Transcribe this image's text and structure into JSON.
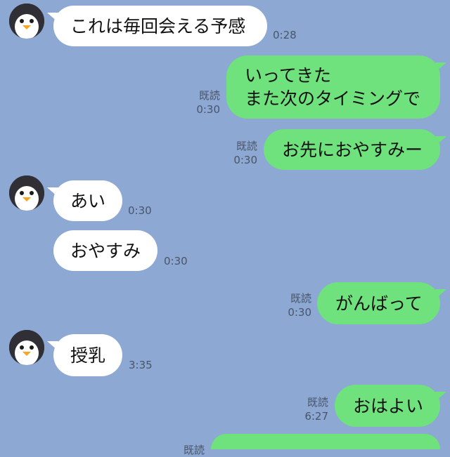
{
  "messages": [
    {
      "side": "in",
      "text": "これは毎回会える予感",
      "time": "0:28"
    },
    {
      "side": "out",
      "lines": [
        "いってきた",
        "また次のタイミングで"
      ],
      "read": "既読",
      "time": "0:30"
    },
    {
      "side": "out",
      "text": "お先におやすみー",
      "read": "既読",
      "time": "0:30"
    },
    {
      "side": "in",
      "text": "あい",
      "time": "0:30"
    },
    {
      "side": "in",
      "text": "おやすみ",
      "time": "0:30"
    },
    {
      "side": "out",
      "text": "がんばって",
      "read": "既読",
      "time": "0:30"
    },
    {
      "side": "in",
      "text": "授乳",
      "time": "3:35"
    },
    {
      "side": "out",
      "text": "おはよい",
      "read": "既読",
      "time": "6:27"
    },
    {
      "side": "out",
      "text": "",
      "read": "既読",
      "time": ""
    }
  ],
  "colors": {
    "background": "#8ca8d3",
    "incoming": "#ffffff",
    "outgoing": "#6fe17d"
  },
  "avatar_icon": "penguin-icon"
}
